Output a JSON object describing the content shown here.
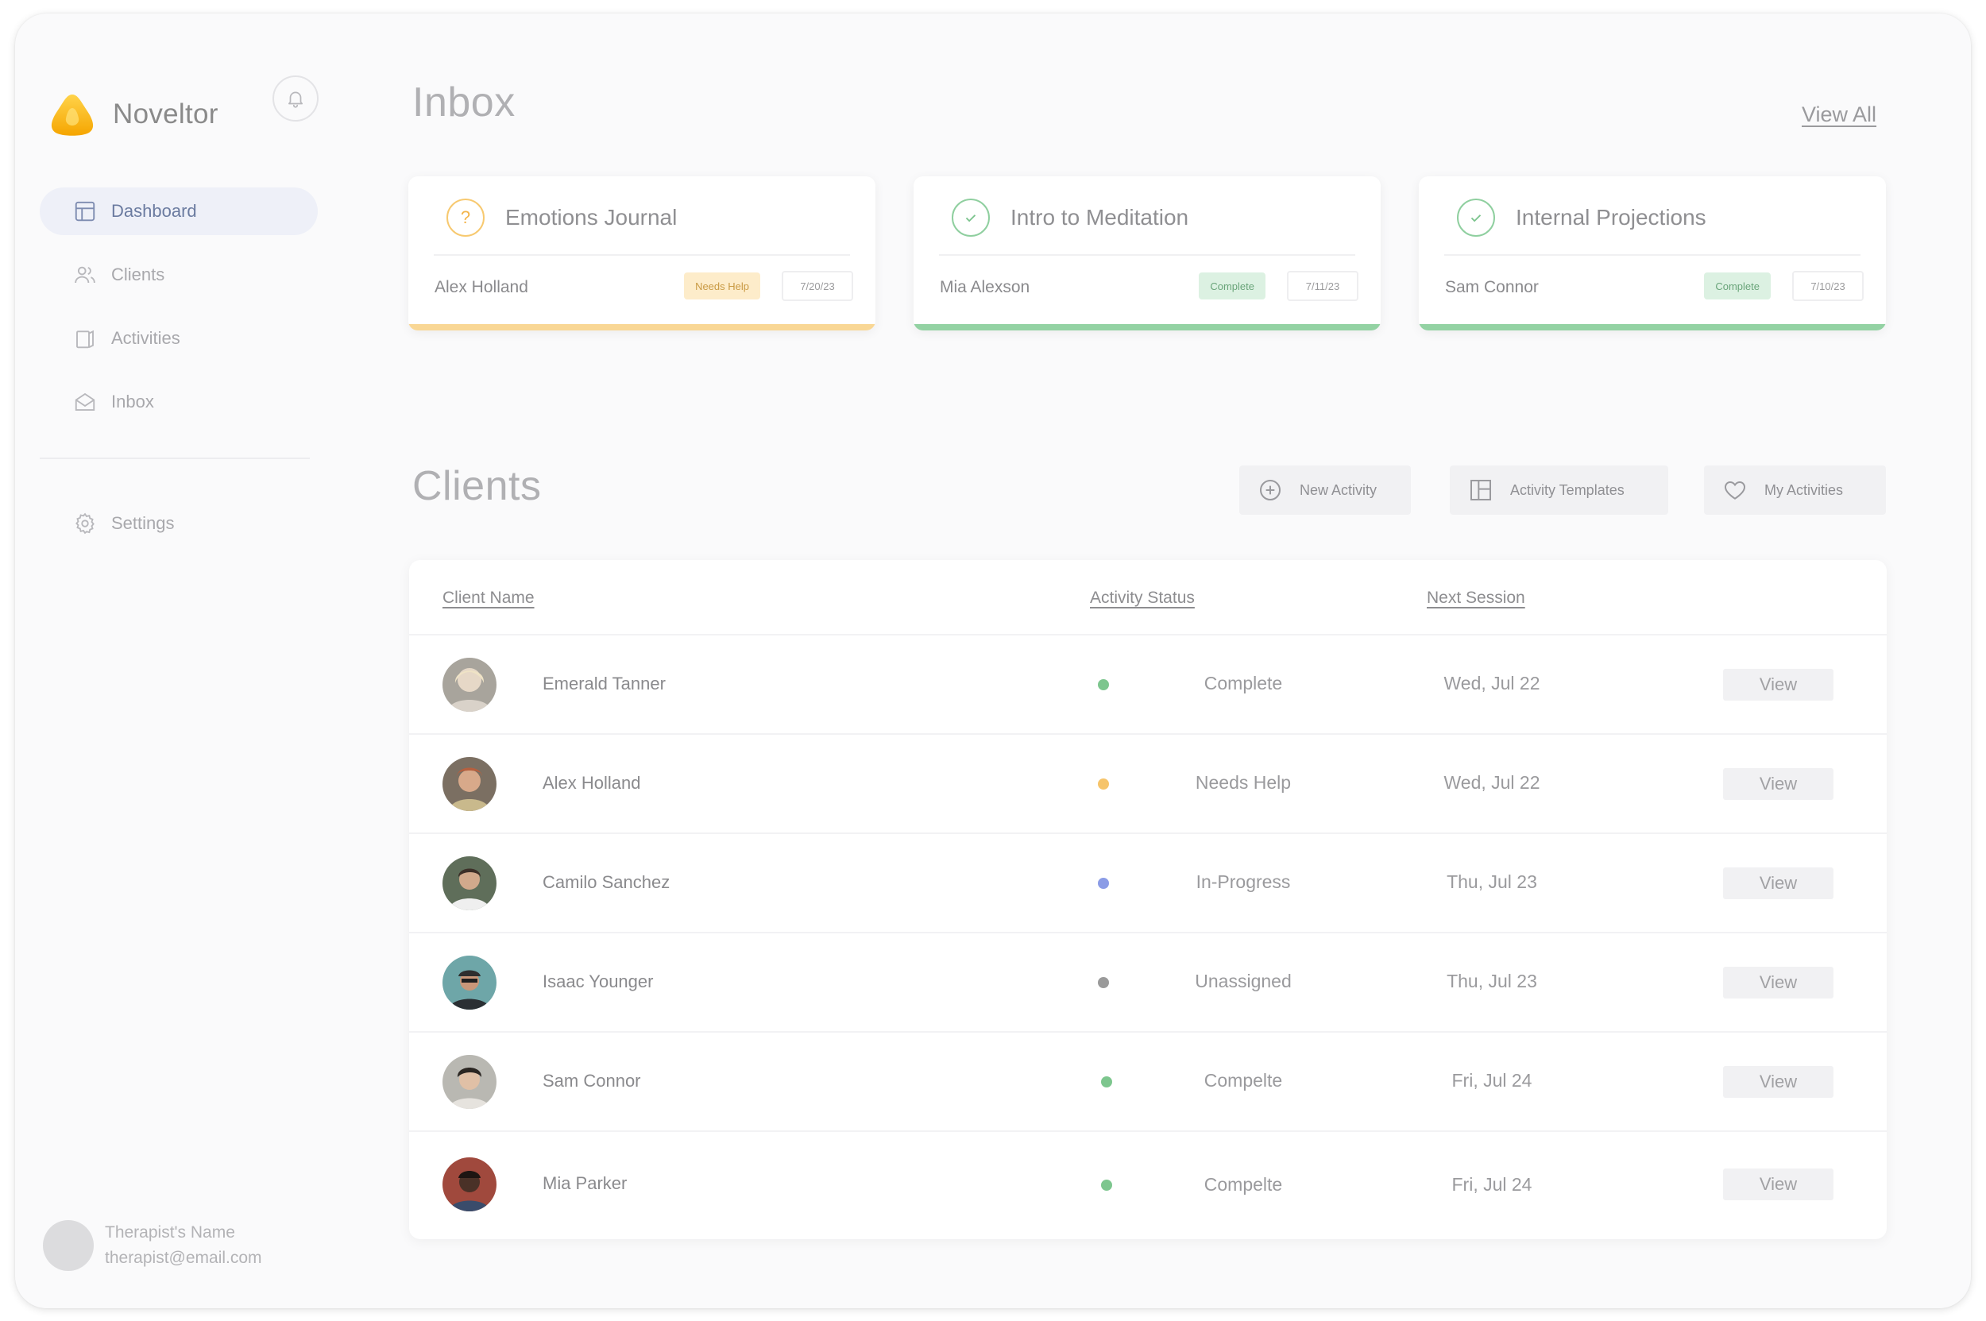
{
  "app": {
    "name": "Noveltor"
  },
  "sidebar": {
    "items": [
      {
        "label": "Dashboard",
        "icon": "dashboard-icon",
        "active": true
      },
      {
        "label": "Clients",
        "icon": "users-icon",
        "active": false
      },
      {
        "label": "Activities",
        "icon": "activities-icon",
        "active": false
      },
      {
        "label": "Inbox",
        "icon": "envelope-icon",
        "active": false
      }
    ],
    "settings": {
      "label": "Settings",
      "icon": "gear-icon"
    },
    "profile": {
      "name": "Therapist's Name",
      "email": "therapist@email.com"
    }
  },
  "inbox": {
    "title": "Inbox",
    "view_all": "View All",
    "cards": [
      {
        "title": "Emotions Journal",
        "client": "Alex Holland",
        "status": "Needs Help",
        "date": "7/20/23",
        "icon": "question-icon",
        "color": "#f7c970"
      },
      {
        "title": "Intro to Meditation",
        "client": "Mia Alexson",
        "status": "Complete",
        "date": "7/11/23",
        "icon": "check-icon",
        "color": "#8fcf9f"
      },
      {
        "title": "Internal Projections",
        "client": "Sam Connor",
        "status": "Complete",
        "date": "7/10/23",
        "icon": "check-icon",
        "color": "#8fcf9f"
      }
    ]
  },
  "clients": {
    "title": "Clients",
    "actions": {
      "new_activity": "New Activity",
      "activity_templates": "Activity Templates",
      "my_activities": "My Activities"
    },
    "columns": {
      "name": "Client Name",
      "status": "Activity Status",
      "session": "Next Session"
    },
    "view_label": "View",
    "rows": [
      {
        "name": "Emerald Tanner",
        "status": "Complete",
        "status_color": "#7dc68e",
        "session": "Wed, Jul 22"
      },
      {
        "name": "Alex Holland",
        "status": "Needs Help",
        "status_color": "#f6c46a",
        "session": "Wed, Jul 22"
      },
      {
        "name": "Camilo Sanchez",
        "status": "In-Progress",
        "status_color": "#8b9ce6",
        "session": "Thu, Jul 23"
      },
      {
        "name": "Isaac Younger",
        "status": "Unassigned",
        "status_color": "#9a9a9a",
        "session": "Thu, Jul 23"
      },
      {
        "name": "Sam Connor",
        "status": "Compelte",
        "status_color": "#7dc68e",
        "session": "Fri, Jul 24"
      },
      {
        "name": "Mia Parker",
        "status": "Compelte",
        "status_color": "#7dc68e",
        "session": "Fri, Jul 24"
      }
    ]
  }
}
